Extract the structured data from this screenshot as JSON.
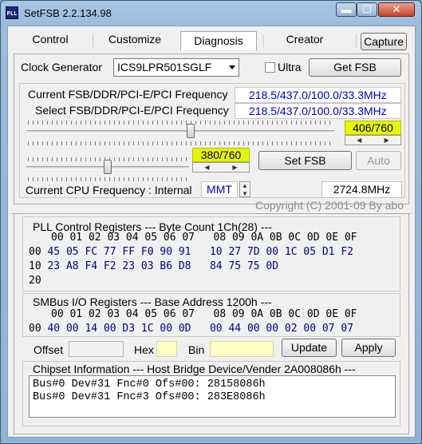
{
  "window": {
    "title": "SetFSB 2.2.134.98",
    "icon_text": "PLL",
    "minimize": "▬",
    "maximize": "☐",
    "close": "✕"
  },
  "tabs": [
    {
      "label": "Control"
    },
    {
      "label": "Customize"
    },
    {
      "label": "Diagnosis"
    },
    {
      "label": "Creator"
    }
  ],
  "capture_label": "Capture",
  "clock": {
    "label": "Clock Generator",
    "value": "ICS9LPR501SGLF",
    "ultra_label": "Ultra",
    "ultra_checked": false,
    "get_fsb": "Get FSB"
  },
  "freq": {
    "current_label": "Current FSB/DDR/PCI-E/PCI Frequency",
    "current_value": "218.5/437.0/100.0/33.3MHz",
    "select_label": "Select FSB/DDR/PCI-E/PCI Frequency",
    "select_value": "218.5/437.0/100.0/33.3MHz"
  },
  "slider1": {
    "readout": "406/760",
    "level": 406,
    "max": 760
  },
  "slider2": {
    "readout": "380/760",
    "level": 380,
    "max": 760
  },
  "set_fsb": "Set FSB",
  "auto": "Auto",
  "cpu": {
    "label": "Current CPU Frequency : Internal",
    "source": "MMT",
    "value": "2724.8MHz"
  },
  "copyright": "Copyright (C) 2001-09 By abo",
  "pll": {
    "title": "PLL Control Registers  --- Byte Count 1Ch(28) ---",
    "header": "00 01 02 03 04 05 06 07   08 09 0A 0B 0C 0D 0E 0F",
    "rows": [
      {
        "addr": "00",
        "data": "45 05 FC 77 FF F0 90 91   10 27 7D 00 1C 05 D1 F2"
      },
      {
        "addr": "10",
        "data": "23 A8 F4 F2 23 03 B6 D8   84 75 75 0D"
      },
      {
        "addr": "20",
        "data": ""
      }
    ]
  },
  "smbus": {
    "title": "SMBus I/O Registers  --- Base Address 1200h ---",
    "header": "00 01 02 03 04 05 06 07   08 09 0A 0B 0C 0D 0E 0F",
    "rows": [
      {
        "addr": "00",
        "data": "40 00 14 00 D3 1C 00 0D   00 44 00 00 02 00 07 07"
      }
    ]
  },
  "edit": {
    "offset_label": "Offset",
    "hex_label": "Hex",
    "bin_label": "Bin",
    "update": "Update",
    "apply": "Apply"
  },
  "chipset": {
    "title": "Chipset Information  --- Host Bridge Device/Vender 2A008086h ---",
    "lines": [
      "Bus#0 Dev#31 Fnc#0 Ofs#00: 28158086h",
      "Bus#0 Dev#31 Fnc#3 Ofs#00: 283E8086h"
    ]
  }
}
